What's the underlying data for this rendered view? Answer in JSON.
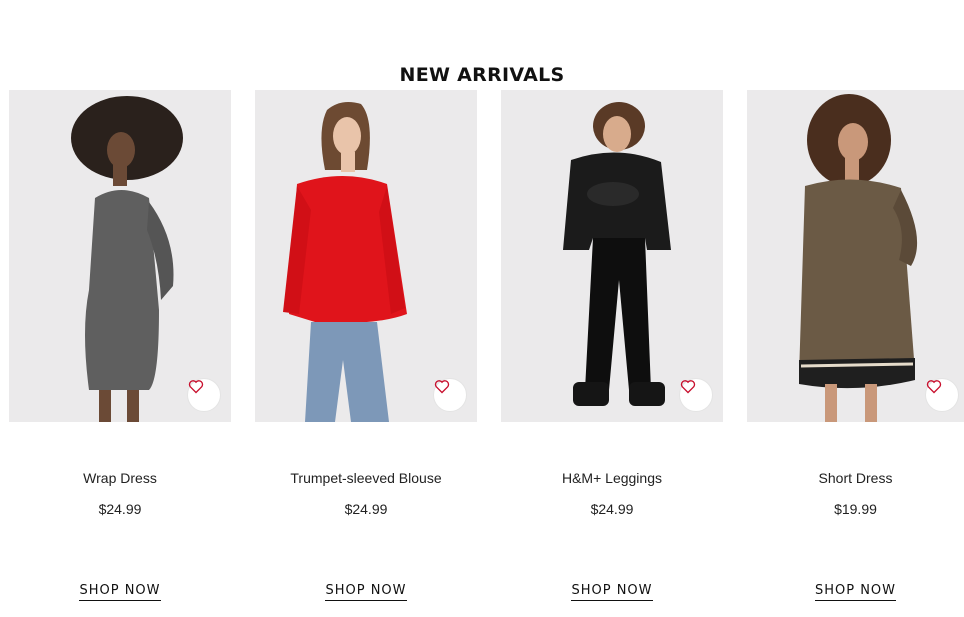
{
  "section": {
    "title": "NEW ARRIVALS"
  },
  "products": [
    {
      "name": "Wrap Dress",
      "price": "$24.99",
      "cta": "SHOP NOW",
      "image": "model in grey glitter wrap dress",
      "favorite_icon": "heart-outline-icon"
    },
    {
      "name": "Trumpet-sleeved Blouse",
      "price": "$24.99",
      "cta": "SHOP NOW",
      "image": "model in red blouse and blue jeans",
      "favorite_icon": "heart-outline-icon"
    },
    {
      "name": "H&M+ Leggings",
      "price": "$24.99",
      "cta": "SHOP NOW",
      "image": "model in black sweatshirt and vinyl leggings",
      "favorite_icon": "heart-outline-icon"
    },
    {
      "name": "Short Dress",
      "price": "$19.99",
      "cta": "SHOP NOW",
      "image": "model in patterned short dress",
      "favorite_icon": "heart-outline-icon"
    }
  ],
  "colors": {
    "accent_heart": "#c8102e",
    "photo_bg": "#ebeaeb",
    "text": "#222222"
  }
}
